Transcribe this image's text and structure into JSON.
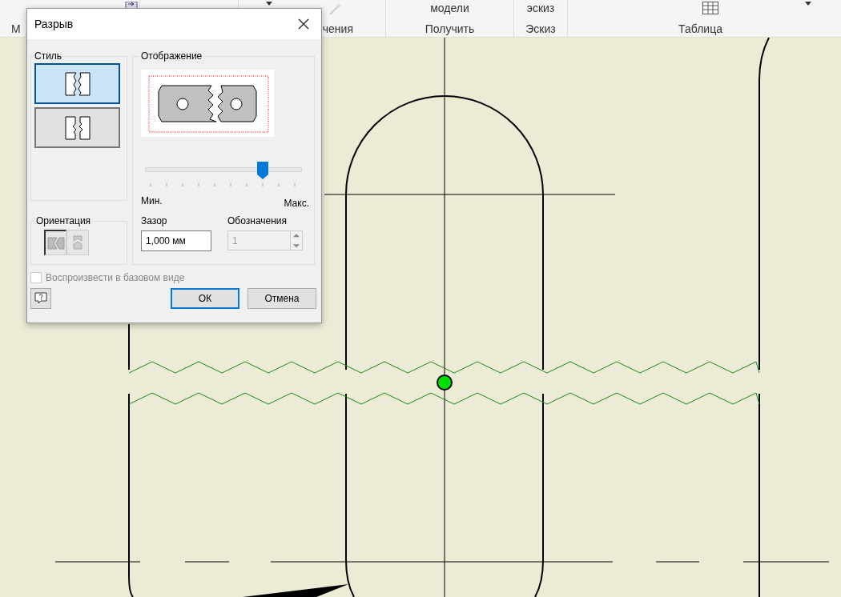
{
  "ribbon": [
    {
      "label": "М"
    },
    {
      "label": "чения"
    },
    {
      "top": "модели",
      "label": "Получить"
    },
    {
      "top": "эскиз",
      "label": "Эскиз"
    },
    {
      "label": "Таблица"
    }
  ],
  "window": {
    "title": "Разрыв"
  },
  "style": {
    "label": "Стиль",
    "options": [
      {
        "kind": "rectangular",
        "selected": true
      },
      {
        "kind": "structural",
        "selected": false
      }
    ]
  },
  "orientation": {
    "label": "Ориентация",
    "options": [
      {
        "kind": "horizontal",
        "selected": true
      },
      {
        "kind": "vertical",
        "selected": false
      }
    ]
  },
  "display": {
    "label": "Отображение",
    "level": 0.75,
    "min_label": "Мин.",
    "max_label": "Макс.",
    "gap": {
      "label": "Зазор",
      "value": "1,000 мм"
    },
    "symbols": {
      "label": "Обозначения",
      "value": "1",
      "disabled": true
    }
  },
  "apply_to_base_view": {
    "label": "Воспроизвести в базовом виде",
    "checked": false,
    "disabled": true
  },
  "buttons": [
    {
      "kind": "help"
    },
    {
      "kind": "ok",
      "label": "ОК",
      "default": true
    },
    {
      "kind": "cancel",
      "label": "Отмена",
      "default": false
    }
  ]
}
